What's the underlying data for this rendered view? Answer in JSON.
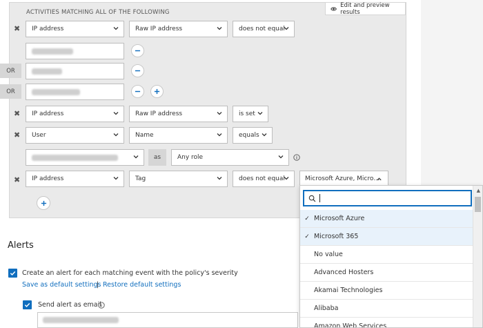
{
  "filters": {
    "section_title": "ACTIVITIES MATCHING ALL OF THE FOLLOWING",
    "preview_label": "Edit and preview results",
    "or_label": "OR",
    "as_label": "as",
    "rows": [
      {
        "field": "IP address",
        "subfield": "Raw IP address",
        "operator": "does not equal"
      },
      {
        "field": "IP address",
        "subfield": "Raw IP address",
        "operator": "is set"
      },
      {
        "field": "User",
        "subfield": "Name",
        "operator": "equals"
      },
      {
        "role": "Any role"
      },
      {
        "field": "IP address",
        "subfield": "Tag",
        "operator": "does not equal",
        "value": "Microsoft Azure, Micro…"
      }
    ]
  },
  "dropdown": {
    "search_value": "",
    "options": [
      {
        "label": "Microsoft Azure",
        "selected": true
      },
      {
        "label": "Microsoft 365",
        "selected": true
      },
      {
        "label": "No value",
        "selected": false
      },
      {
        "label": "Advanced Hosters",
        "selected": false
      },
      {
        "label": "Akamai Technologies",
        "selected": false
      },
      {
        "label": "Alibaba",
        "selected": false
      },
      {
        "label": "Amazon Web Services",
        "selected": false
      }
    ]
  },
  "alerts": {
    "title": "Alerts",
    "create_alert_label": "Create an alert for each matching event with the policy's severity",
    "save_default_label": "Save as default settings",
    "separator": "|",
    "restore_default_label": "Restore default settings",
    "send_email_label": "Send alert as email"
  },
  "colors": {
    "accent": "#106ebe",
    "panel": "#eaeaea"
  }
}
